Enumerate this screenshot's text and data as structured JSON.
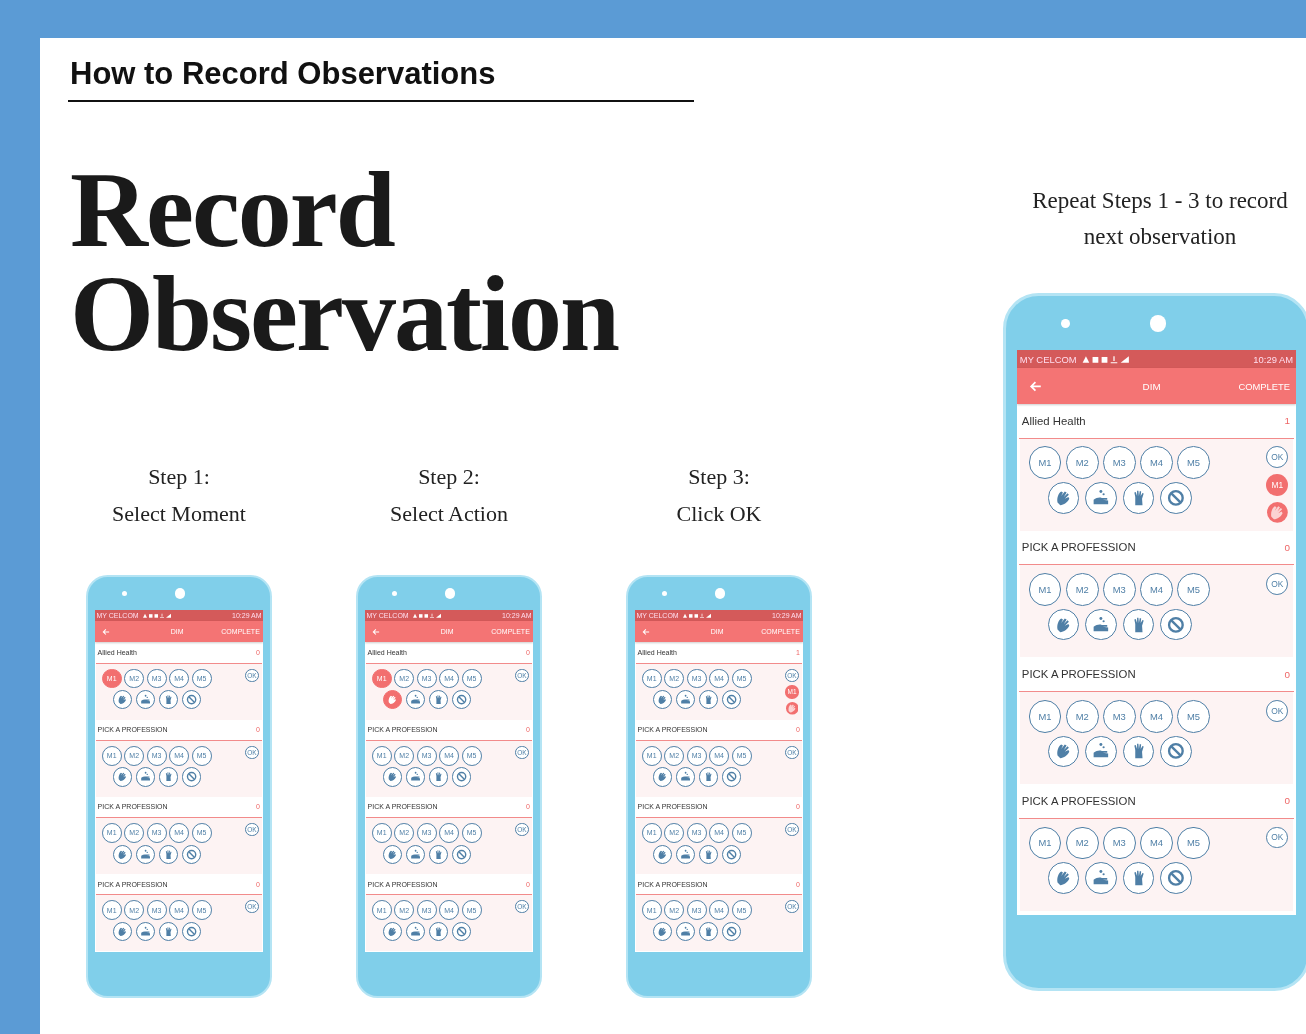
{
  "heading": "How to Record Observations",
  "title_lines": [
    "Record",
    "Observation"
  ],
  "steps": [
    {
      "label": "Step 1:",
      "text": "Select Moment",
      "phone": {
        "status": {
          "carrier": "MY CELCOM",
          "time": "10:29 AM"
        },
        "app_bar": {
          "title": "DIM",
          "action": "COMPLETE"
        },
        "sections": [
          {
            "header": "Allied Health",
            "count": "0",
            "ok": "OK",
            "moments": [
              {
                "label": "M1",
                "selected": true
              },
              {
                "label": "M2",
                "selected": false
              },
              {
                "label": "M3",
                "selected": false
              },
              {
                "label": "M4",
                "selected": false
              },
              {
                "label": "M5",
                "selected": false
              }
            ],
            "actions": [
              {
                "kind": "handrub",
                "selected": false
              },
              {
                "kind": "handwash",
                "selected": false
              },
              {
                "kind": "glove",
                "selected": false
              },
              {
                "kind": "missed",
                "selected": false
              }
            ]
          },
          {
            "header": "PICK A PROFESSION",
            "count": "0",
            "ok": "OK",
            "moments": [
              {
                "label": "M1",
                "selected": false
              },
              {
                "label": "M2",
                "selected": false
              },
              {
                "label": "M3",
                "selected": false
              },
              {
                "label": "M4",
                "selected": false
              },
              {
                "label": "M5",
                "selected": false
              }
            ],
            "actions": [
              {
                "kind": "handrub",
                "selected": false
              },
              {
                "kind": "handwash",
                "selected": false
              },
              {
                "kind": "glove",
                "selected": false
              },
              {
                "kind": "missed",
                "selected": false
              }
            ]
          },
          {
            "header": "PICK A PROFESSION",
            "count": "0",
            "ok": "OK",
            "moments": [
              {
                "label": "M1",
                "selected": false
              },
              {
                "label": "M2",
                "selected": false
              },
              {
                "label": "M3",
                "selected": false
              },
              {
                "label": "M4",
                "selected": false
              },
              {
                "label": "M5",
                "selected": false
              }
            ],
            "actions": [
              {
                "kind": "handrub",
                "selected": false
              },
              {
                "kind": "handwash",
                "selected": false
              },
              {
                "kind": "glove",
                "selected": false
              },
              {
                "kind": "missed",
                "selected": false
              }
            ]
          },
          {
            "header": "PICK A PROFESSION",
            "count": "0",
            "ok": "OK",
            "moments": [
              {
                "label": "M1",
                "selected": false
              },
              {
                "label": "M2",
                "selected": false
              },
              {
                "label": "M3",
                "selected": false
              },
              {
                "label": "M4",
                "selected": false
              },
              {
                "label": "M5",
                "selected": false
              }
            ],
            "actions": [
              {
                "kind": "handrub",
                "selected": false
              },
              {
                "kind": "handwash",
                "selected": false
              },
              {
                "kind": "glove",
                "selected": false
              },
              {
                "kind": "missed",
                "selected": false
              }
            ]
          }
        ]
      }
    },
    {
      "label": "Step 2:",
      "text": "Select Action",
      "phone": {
        "status": {
          "carrier": "MY CELCOM",
          "time": "10:29 AM"
        },
        "app_bar": {
          "title": "DIM",
          "action": "COMPLETE"
        },
        "sections": [
          {
            "header": "Allied Health",
            "count": "0",
            "ok": "OK",
            "moments": [
              {
                "label": "M1",
                "selected": true
              },
              {
                "label": "M2",
                "selected": false
              },
              {
                "label": "M3",
                "selected": false
              },
              {
                "label": "M4",
                "selected": false
              },
              {
                "label": "M5",
                "selected": false
              }
            ],
            "actions": [
              {
                "kind": "handrub",
                "selected": true
              },
              {
                "kind": "handwash",
                "selected": false
              },
              {
                "kind": "glove",
                "selected": false
              },
              {
                "kind": "missed",
                "selected": false
              }
            ]
          },
          {
            "header": "PICK A PROFESSION",
            "count": "0",
            "ok": "OK",
            "moments": [
              {
                "label": "M1",
                "selected": false
              },
              {
                "label": "M2",
                "selected": false
              },
              {
                "label": "M3",
                "selected": false
              },
              {
                "label": "M4",
                "selected": false
              },
              {
                "label": "M5",
                "selected": false
              }
            ],
            "actions": [
              {
                "kind": "handrub",
                "selected": false
              },
              {
                "kind": "handwash",
                "selected": false
              },
              {
                "kind": "glove",
                "selected": false
              },
              {
                "kind": "missed",
                "selected": false
              }
            ]
          },
          {
            "header": "PICK A PROFESSION",
            "count": "0",
            "ok": "OK",
            "moments": [
              {
                "label": "M1",
                "selected": false
              },
              {
                "label": "M2",
                "selected": false
              },
              {
                "label": "M3",
                "selected": false
              },
              {
                "label": "M4",
                "selected": false
              },
              {
                "label": "M5",
                "selected": false
              }
            ],
            "actions": [
              {
                "kind": "handrub",
                "selected": false
              },
              {
                "kind": "handwash",
                "selected": false
              },
              {
                "kind": "glove",
                "selected": false
              },
              {
                "kind": "missed",
                "selected": false
              }
            ]
          },
          {
            "header": "PICK A PROFESSION",
            "count": "0",
            "ok": "OK",
            "moments": [
              {
                "label": "M1",
                "selected": false
              },
              {
                "label": "M2",
                "selected": false
              },
              {
                "label": "M3",
                "selected": false
              },
              {
                "label": "M4",
                "selected": false
              },
              {
                "label": "M5",
                "selected": false
              }
            ],
            "actions": [
              {
                "kind": "handrub",
                "selected": false
              },
              {
                "kind": "handwash",
                "selected": false
              },
              {
                "kind": "glove",
                "selected": false
              },
              {
                "kind": "missed",
                "selected": false
              }
            ]
          }
        ]
      }
    },
    {
      "label": "Step 3:",
      "text": "Click OK",
      "phone": {
        "status": {
          "carrier": "MY CELCOM",
          "time": "10:29 AM"
        },
        "app_bar": {
          "title": "DIM",
          "action": "COMPLETE"
        },
        "sections": [
          {
            "header": "Allied Health",
            "count": "1",
            "ok": "OK",
            "recorded": {
              "moment": "M1",
              "kind": "handrub"
            },
            "moments": [
              {
                "label": "M1",
                "selected": false
              },
              {
                "label": "M2",
                "selected": false
              },
              {
                "label": "M3",
                "selected": false
              },
              {
                "label": "M4",
                "selected": false
              },
              {
                "label": "M5",
                "selected": false
              }
            ],
            "actions": [
              {
                "kind": "handrub",
                "selected": false
              },
              {
                "kind": "handwash",
                "selected": false
              },
              {
                "kind": "glove",
                "selected": false
              },
              {
                "kind": "missed",
                "selected": false
              }
            ]
          },
          {
            "header": "PICK A PROFESSION",
            "count": "0",
            "ok": "OK",
            "moments": [
              {
                "label": "M1",
                "selected": false
              },
              {
                "label": "M2",
                "selected": false
              },
              {
                "label": "M3",
                "selected": false
              },
              {
                "label": "M4",
                "selected": false
              },
              {
                "label": "M5",
                "selected": false
              }
            ],
            "actions": [
              {
                "kind": "handrub",
                "selected": false
              },
              {
                "kind": "handwash",
                "selected": false
              },
              {
                "kind": "glove",
                "selected": false
              },
              {
                "kind": "missed",
                "selected": false
              }
            ]
          },
          {
            "header": "PICK A PROFESSION",
            "count": "0",
            "ok": "OK",
            "moments": [
              {
                "label": "M1",
                "selected": false
              },
              {
                "label": "M2",
                "selected": false
              },
              {
                "label": "M3",
                "selected": false
              },
              {
                "label": "M4",
                "selected": false
              },
              {
                "label": "M5",
                "selected": false
              }
            ],
            "actions": [
              {
                "kind": "handrub",
                "selected": false
              },
              {
                "kind": "handwash",
                "selected": false
              },
              {
                "kind": "glove",
                "selected": false
              },
              {
                "kind": "missed",
                "selected": false
              }
            ]
          },
          {
            "header": "PICK A PROFESSION",
            "count": "0",
            "ok": "OK",
            "moments": [
              {
                "label": "M1",
                "selected": false
              },
              {
                "label": "M2",
                "selected": false
              },
              {
                "label": "M3",
                "selected": false
              },
              {
                "label": "M4",
                "selected": false
              },
              {
                "label": "M5",
                "selected": false
              }
            ],
            "actions": [
              {
                "kind": "handrub",
                "selected": false
              },
              {
                "kind": "handwash",
                "selected": false
              },
              {
                "kind": "glove",
                "selected": false
              },
              {
                "kind": "missed",
                "selected": false
              }
            ]
          }
        ]
      }
    }
  ],
  "repeat": {
    "note": "Repeat Steps 1 - 3 to record next observation",
    "phone": {
      "status": {
        "carrier": "MY CELCOM",
        "time": "10:29 AM"
      },
      "app_bar": {
        "title": "DIM",
        "action": "COMPLETE"
      },
      "sections": [
        {
          "header": "Allied Health",
          "count": "1",
          "ok": "OK",
          "recorded": {
            "moment": "M1",
            "kind": "handrub"
          },
          "moments": [
            {
              "label": "M1",
              "selected": false
            },
            {
              "label": "M2",
              "selected": false
            },
            {
              "label": "M3",
              "selected": false
            },
            {
              "label": "M4",
              "selected": false
            },
            {
              "label": "M5",
              "selected": false
            }
          ],
          "actions": [
            {
              "kind": "handrub",
              "selected": false
            },
            {
              "kind": "handwash",
              "selected": false
            },
            {
              "kind": "glove",
              "selected": false
            },
            {
              "kind": "missed",
              "selected": false
            }
          ]
        },
        {
          "header": "PICK A PROFESSION",
          "count": "0",
          "ok": "OK",
          "moments": [
            {
              "label": "M1",
              "selected": false
            },
            {
              "label": "M2",
              "selected": false
            },
            {
              "label": "M3",
              "selected": false
            },
            {
              "label": "M4",
              "selected": false
            },
            {
              "label": "M5",
              "selected": false
            }
          ],
          "actions": [
            {
              "kind": "handrub",
              "selected": false
            },
            {
              "kind": "handwash",
              "selected": false
            },
            {
              "kind": "glove",
              "selected": false
            },
            {
              "kind": "missed",
              "selected": false
            }
          ]
        },
        {
          "header": "PICK A PROFESSION",
          "count": "0",
          "ok": "OK",
          "moments": [
            {
              "label": "M1",
              "selected": false
            },
            {
              "label": "M2",
              "selected": false
            },
            {
              "label": "M3",
              "selected": false
            },
            {
              "label": "M4",
              "selected": false
            },
            {
              "label": "M5",
              "selected": false
            }
          ],
          "actions": [
            {
              "kind": "handrub",
              "selected": false
            },
            {
              "kind": "handwash",
              "selected": false
            },
            {
              "kind": "glove",
              "selected": false
            },
            {
              "kind": "missed",
              "selected": false
            }
          ]
        },
        {
          "header": "PICK A PROFESSION",
          "count": "0",
          "ok": "OK",
          "moments": [
            {
              "label": "M1",
              "selected": false
            },
            {
              "label": "M2",
              "selected": false
            },
            {
              "label": "M3",
              "selected": false
            },
            {
              "label": "M4",
              "selected": false
            },
            {
              "label": "M5",
              "selected": false
            }
          ],
          "actions": [
            {
              "kind": "handrub",
              "selected": false
            },
            {
              "kind": "handwash",
              "selected": false
            },
            {
              "kind": "glove",
              "selected": false
            },
            {
              "kind": "missed",
              "selected": false
            }
          ]
        }
      ]
    }
  }
}
